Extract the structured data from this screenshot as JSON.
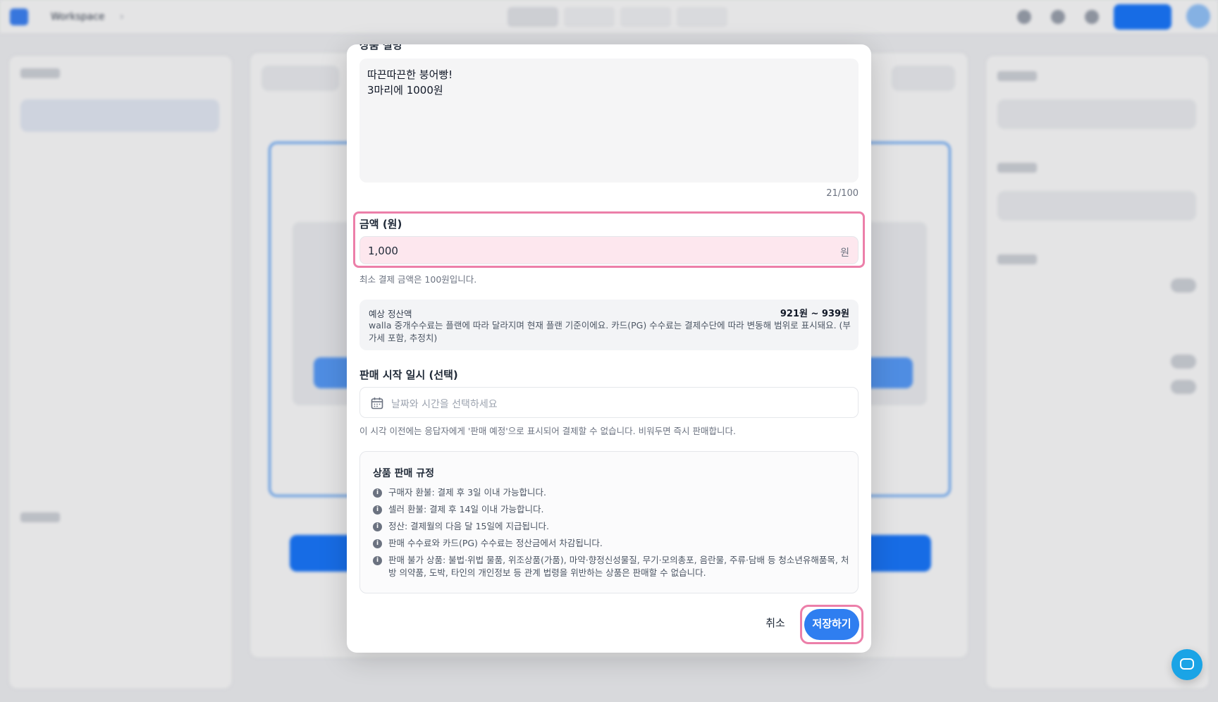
{
  "app": {
    "breadcrumb": {
      "workspace": "Workspace",
      "separator": "›",
      "page": ""
    }
  },
  "modal": {
    "section_label": "상품 설명",
    "description": {
      "value_line1": "따끈따끈한 붕어빵!",
      "value_line2": "3마리에 1000원",
      "char_count": "21/100"
    },
    "price": {
      "label": "금액 (원)",
      "value": "1,000",
      "unit": "원",
      "min_note": "최소 결제 금액은 100원입니다."
    },
    "settlement": {
      "title": "예상 정산액",
      "amount": "921원 ~ 939원",
      "description": "walla 중개수수료는 플랜에 따라 달라지며 현재 플랜 기준이에요. 카드(PG) 수수료는 결제수단에 따라 변동해 범위로 표시돼요. (부가세 포함, 추정치)"
    },
    "sale_start": {
      "label": "판매 시작 일시 (선택)",
      "placeholder": "날짜와 시간을 선택하세요",
      "note": "이 시각 이전에는 응답자에게 '판매 예정'으로 표시되어 결제할 수 없습니다. 비워두면 즉시 판매합니다."
    },
    "rules": {
      "title": "상품 판매 규정",
      "items": [
        "구매자 환불: 결제 후 3일 이내 가능합니다.",
        "셀러 환불: 결제 후 14일 이내 가능합니다.",
        "정산: 결제월의 다음 달 15일에 지급됩니다.",
        "판매 수수료와 카드(PG) 수수료는 정산금에서 차감됩니다.",
        "판매 불가 상품: 불법·위법 물품, 위조상품(가품), 마약·향정신성물질, 무기·모의총포, 음란물, 주류·담배 등 청소년유해품목, 처방 의약품, 도박, 타인의 개인정보 등 관계 법령을 위반하는 상품은 판매할 수 없습니다."
      ]
    },
    "actions": {
      "cancel": "취소",
      "save": "저장하기"
    }
  },
  "colors": {
    "primary": "#2f7ef0",
    "highlight_border": "#ec7fa9",
    "price_field_bg": "#fde7ee"
  },
  "icons": [
    "calendar-icon",
    "info-icon",
    "chat-icon"
  ]
}
